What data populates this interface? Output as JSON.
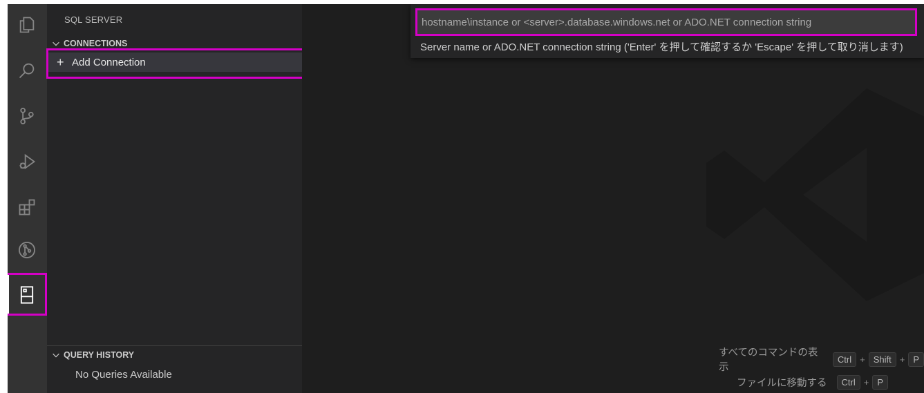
{
  "sidebar": {
    "title": "SQL SERVER",
    "connections_header": "CONNECTIONS",
    "add_connection_label": "Add Connection",
    "query_history_header": "QUERY HISTORY",
    "no_queries_text": "No Queries Available"
  },
  "activity_bar": {
    "items": [
      "explorer-icon",
      "search-icon",
      "source-control-icon",
      "run-debug-icon",
      "extensions-icon",
      "git-graph-icon",
      "sql-server-icon"
    ],
    "active": "sql-server-icon"
  },
  "quick_input": {
    "placeholder": "hostname\\instance or <server>.database.windows.net or ADO.NET connection string",
    "value": "",
    "message": "Server name or ADO.NET connection string ('Enter' を押して確認するか 'Escape' を押して取り消します)"
  },
  "shortcuts": {
    "show_all_commands": {
      "label": "すべてのコマンドの表示",
      "keys": [
        "Ctrl",
        "Shift",
        "P"
      ],
      "separator": "+"
    },
    "go_to_file": {
      "label": "ファイルに移動する",
      "keys": [
        "Ctrl",
        "P"
      ],
      "separator": "+"
    }
  },
  "colors": {
    "highlight": "#d400c6",
    "activity_bar": "#333333",
    "sidebar": "#252526",
    "editor": "#1e1e1e"
  }
}
